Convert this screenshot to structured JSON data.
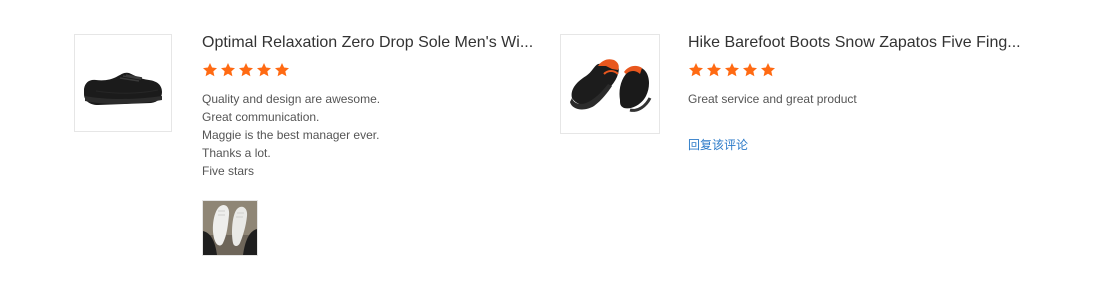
{
  "reviews": [
    {
      "title": "Optimal Relaxation Zero Drop Sole Men's Wi...",
      "rating": 5,
      "lines": [
        "Quality and design are awesome.",
        "Great communication.",
        "Maggie is the best manager ever.",
        "Thanks a lot.",
        "Five stars"
      ],
      "product_image": "black-sneaker",
      "has_photo": true
    },
    {
      "title": "Hike Barefoot Boots Snow Zapatos Five Fing...",
      "rating": 5,
      "lines": [
        "Great service and great product"
      ],
      "product_image": "barefoot-boot",
      "reply_label": "回复该评论"
    }
  ],
  "colors": {
    "star": "#ff6a13",
    "reply_link": "#2b7ac8"
  }
}
